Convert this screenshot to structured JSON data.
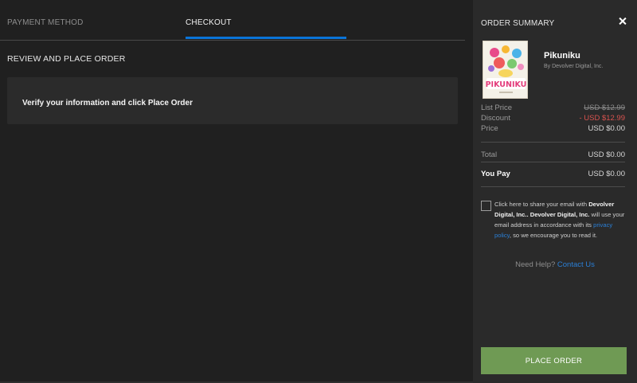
{
  "tabs": [
    {
      "label": "PAYMENT METHOD"
    },
    {
      "label": "CHECKOUT"
    }
  ],
  "section_title": "REVIEW AND PLACE ORDER",
  "verify_text": "Verify your information and click Place Order",
  "summary": {
    "title": "ORDER SUMMARY",
    "product": {
      "name": "Pikuniku",
      "by": "By Devolver Digital, Inc.",
      "cover_logo": "PIKUNIKU"
    },
    "list_price_label": "List Price",
    "list_price_value": "USD $12.99",
    "discount_label": "Discount",
    "discount_value": "- USD $12.99",
    "price_label": "Price",
    "price_value": "USD $0.00",
    "total_label": "Total",
    "total_value": "USD $0.00",
    "you_pay_label": "You Pay",
    "you_pay_value": "USD $0.00"
  },
  "consent": {
    "part1": "Click here to share your email with",
    "publisher": "Devolver Digital, Inc.. Devolver Digital, Inc.",
    "part2": "will use your email address in accordance with its",
    "policy_link": "privacy policy",
    "part3": ", so we encourage you to read it."
  },
  "help": {
    "text": "Need Help?",
    "contact": "Contact Us"
  },
  "place_order_label": "PLACE ORDER",
  "colors": {
    "accent": "#0a74d8",
    "button": "#6f9a54",
    "discount": "#d9534f"
  }
}
